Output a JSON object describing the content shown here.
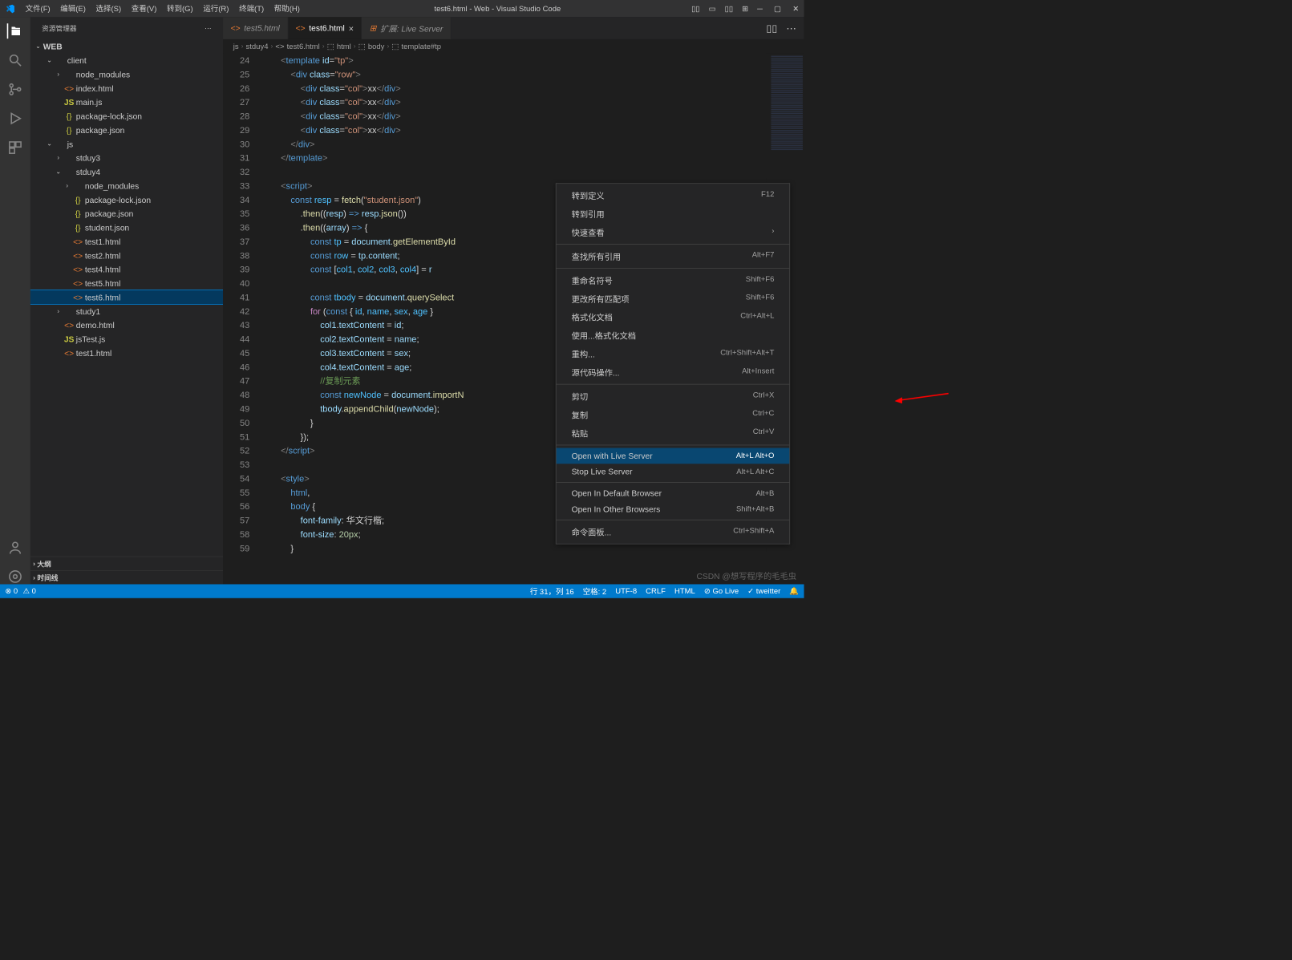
{
  "window_title": "test6.html - Web - Visual Studio Code",
  "menus": [
    "文件(F)",
    "编辑(E)",
    "选择(S)",
    "查看(V)",
    "转到(G)",
    "运行(R)",
    "终端(T)",
    "帮助(H)"
  ],
  "sidebar": {
    "title": "资源管理器",
    "root": "WEB",
    "sections": [
      "大纲",
      "时间线"
    ]
  },
  "tree": [
    {
      "depth": 1,
      "chev": "v",
      "icon": "",
      "label": "client",
      "cls": ""
    },
    {
      "depth": 2,
      "chev": ">",
      "icon": "",
      "label": "node_modules",
      "cls": ""
    },
    {
      "depth": 2,
      "chev": "",
      "icon": "<>",
      "iconcls": "icon-html",
      "label": "index.html",
      "cls": ""
    },
    {
      "depth": 2,
      "chev": "",
      "icon": "JS",
      "iconcls": "icon-js",
      "label": "main.js",
      "cls": ""
    },
    {
      "depth": 2,
      "chev": "",
      "icon": "{}",
      "iconcls": "icon-json",
      "label": "package-lock.json",
      "cls": ""
    },
    {
      "depth": 2,
      "chev": "",
      "icon": "{}",
      "iconcls": "icon-json",
      "label": "package.json",
      "cls": ""
    },
    {
      "depth": 1,
      "chev": "v",
      "icon": "",
      "label": "js",
      "cls": ""
    },
    {
      "depth": 2,
      "chev": ">",
      "icon": "",
      "label": "stduy3",
      "cls": ""
    },
    {
      "depth": 2,
      "chev": "v",
      "icon": "",
      "label": "stduy4",
      "cls": ""
    },
    {
      "depth": 3,
      "chev": ">",
      "icon": "",
      "label": "node_modules",
      "cls": ""
    },
    {
      "depth": 3,
      "chev": "",
      "icon": "{}",
      "iconcls": "icon-json",
      "label": "package-lock.json",
      "cls": ""
    },
    {
      "depth": 3,
      "chev": "",
      "icon": "{}",
      "iconcls": "icon-json",
      "label": "package.json",
      "cls": ""
    },
    {
      "depth": 3,
      "chev": "",
      "icon": "{}",
      "iconcls": "icon-json",
      "label": "student.json",
      "cls": ""
    },
    {
      "depth": 3,
      "chev": "",
      "icon": "<>",
      "iconcls": "icon-html",
      "label": "test1.html",
      "cls": ""
    },
    {
      "depth": 3,
      "chev": "",
      "icon": "<>",
      "iconcls": "icon-html",
      "label": "test2.html",
      "cls": ""
    },
    {
      "depth": 3,
      "chev": "",
      "icon": "<>",
      "iconcls": "icon-html",
      "label": "test4.html",
      "cls": ""
    },
    {
      "depth": 3,
      "chev": "",
      "icon": "<>",
      "iconcls": "icon-html",
      "label": "test5.html",
      "cls": ""
    },
    {
      "depth": 3,
      "chev": "",
      "icon": "<>",
      "iconcls": "icon-html",
      "label": "test6.html",
      "cls": "selected"
    },
    {
      "depth": 2,
      "chev": ">",
      "icon": "",
      "label": "study1",
      "cls": ""
    },
    {
      "depth": 2,
      "chev": "",
      "icon": "<>",
      "iconcls": "icon-html",
      "label": "demo.html",
      "cls": ""
    },
    {
      "depth": 2,
      "chev": "",
      "icon": "JS",
      "iconcls": "icon-js",
      "label": "jsTest.js",
      "cls": ""
    },
    {
      "depth": 2,
      "chev": "",
      "icon": "<>",
      "iconcls": "icon-html",
      "label": "test1.html",
      "cls": ""
    }
  ],
  "tabs": [
    {
      "icon": "<>",
      "label": "test5.html",
      "active": false
    },
    {
      "icon": "<>",
      "label": "test6.html",
      "active": true,
      "close": true
    },
    {
      "icon": "⊞",
      "label": "扩展: Live Server",
      "active": false,
      "italic": true
    }
  ],
  "breadcrumbs": [
    "js",
    "stduy4",
    "test6.html",
    "html",
    "body",
    "template#tp"
  ],
  "code_start_line": 24,
  "code_lines": [
    "        <span class='t-tag'>&lt;</span><span class='t-name'>template</span> <span class='t-attr'>id</span><span class='t-op'>=</span><span class='t-str'>\"tp\"</span><span class='t-tag'>&gt;</span>",
    "            <span class='t-tag'>&lt;</span><span class='t-name'>div</span> <span class='t-attr'>class</span><span class='t-op'>=</span><span class='t-str'>\"row\"</span><span class='t-tag'>&gt;</span>",
    "                <span class='t-tag'>&lt;</span><span class='t-name'>div</span> <span class='t-attr'>class</span><span class='t-op'>=</span><span class='t-str'>\"col\"</span><span class='t-tag'>&gt;</span>xx<span class='t-tag'>&lt;/</span><span class='t-name'>div</span><span class='t-tag'>&gt;</span>",
    "                <span class='t-tag'>&lt;</span><span class='t-name'>div</span> <span class='t-attr'>class</span><span class='t-op'>=</span><span class='t-str'>\"col\"</span><span class='t-tag'>&gt;</span>xx<span class='t-tag'>&lt;/</span><span class='t-name'>div</span><span class='t-tag'>&gt;</span>",
    "                <span class='t-tag'>&lt;</span><span class='t-name'>div</span> <span class='t-attr'>class</span><span class='t-op'>=</span><span class='t-str'>\"col\"</span><span class='t-tag'>&gt;</span>xx<span class='t-tag'>&lt;/</span><span class='t-name'>div</span><span class='t-tag'>&gt;</span>",
    "                <span class='t-tag'>&lt;</span><span class='t-name'>div</span> <span class='t-attr'>class</span><span class='t-op'>=</span><span class='t-str'>\"col\"</span><span class='t-tag'>&gt;</span>xx<span class='t-tag'>&lt;/</span><span class='t-name'>div</span><span class='t-tag'>&gt;</span>",
    "            <span class='t-tag'>&lt;/</span><span class='t-name'>div</span><span class='t-tag'>&gt;</span>",
    "        <span class='t-tag'>&lt;/</span><span class='t-name'>template</span><span class='t-tag'>&gt;</span>",
    "",
    "        <span class='t-tag'>&lt;</span><span class='t-name'>script</span><span class='t-tag'>&gt;</span>",
    "            <span class='t-kw'>const</span> <span class='t-const'>resp</span> <span class='t-op'>=</span> <span class='t-fn'>fetch</span>(<span class='t-str'>\"student.json\"</span>)",
    "                .<span class='t-fn'>then</span>((<span class='t-var'>resp</span>) <span class='t-kw'>=&gt;</span> <span class='t-var'>resp</span>.<span class='t-fn'>json</span>())",
    "                .<span class='t-fn'>then</span>((<span class='t-var'>array</span>) <span class='t-kw'>=&gt;</span> {",
    "                    <span class='t-kw'>const</span> <span class='t-const'>tp</span> <span class='t-op'>=</span> <span class='t-var'>document</span>.<span class='t-fn'>getElementById</span>",
    "                    <span class='t-kw'>const</span> <span class='t-const'>row</span> <span class='t-op'>=</span> <span class='t-var'>tp</span>.<span class='t-var'>content</span>;",
    "                    <span class='t-kw'>const</span> [<span class='t-const'>col1</span>, <span class='t-const'>col2</span>, <span class='t-const'>col3</span>, <span class='t-const'>col4</span>] <span class='t-op'>=</span> <span class='t-var'>r</span>",
    "",
    "                    <span class='t-kw'>const</span> <span class='t-const'>tbody</span> <span class='t-op'>=</span> <span class='t-var'>document</span>.<span class='t-fn'>querySelect</span>",
    "                    <span class='t-kw2'>for</span> (<span class='t-kw'>const</span> { <span class='t-const'>id</span>, <span class='t-const'>name</span>, <span class='t-const'>sex</span>, <span class='t-const'>age</span> }",
    "                        <span class='t-var'>col1</span>.<span class='t-var'>textContent</span> <span class='t-op'>=</span> <span class='t-var'>id</span>;",
    "                        <span class='t-var'>col2</span>.<span class='t-var'>textContent</span> <span class='t-op'>=</span> <span class='t-var'>name</span>;",
    "                        <span class='t-var'>col3</span>.<span class='t-var'>textContent</span> <span class='t-op'>=</span> <span class='t-var'>sex</span>;",
    "                        <span class='t-var'>col4</span>.<span class='t-var'>textContent</span> <span class='t-op'>=</span> <span class='t-var'>age</span>;",
    "                        <span class='t-cmt'>//复制元素</span>",
    "                        <span class='t-kw'>const</span> <span class='t-const'>newNode</span> <span class='t-op'>=</span> <span class='t-var'>document</span>.<span class='t-fn'>importN</span>",
    "                        <span class='t-var'>tbody</span>.<span class='t-fn'>appendChild</span>(<span class='t-var'>newNode</span>);",
    "                    }",
    "                });",
    "        <span class='t-tag'>&lt;/</span><span class='t-name'>script</span><span class='t-tag'>&gt;</span>",
    "",
    "        <span class='t-tag'>&lt;</span><span class='t-name'>style</span><span class='t-tag'>&gt;</span>",
    "            <span class='t-name'>html</span>,",
    "            <span class='t-name'>body</span> {",
    "                <span class='t-attr'>font-family</span>: 华文行楷;",
    "                <span class='t-attr'>font-size</span>: <span class='t-num'>20px</span>;",
    "            }"
  ],
  "context_menu": [
    {
      "label": "转到定义",
      "shortcut": "F12"
    },
    {
      "label": "转到引用",
      "shortcut": ""
    },
    {
      "label": "快速查看",
      "shortcut": "",
      "arrow": true
    },
    {
      "sep": true
    },
    {
      "label": "查找所有引用",
      "shortcut": "Alt+F7"
    },
    {
      "sep": true
    },
    {
      "label": "重命名符号",
      "shortcut": "Shift+F6"
    },
    {
      "label": "更改所有匹配项",
      "shortcut": "Shift+F6"
    },
    {
      "label": "格式化文档",
      "shortcut": "Ctrl+Alt+L"
    },
    {
      "label": "使用...格式化文档",
      "shortcut": ""
    },
    {
      "label": "重构...",
      "shortcut": "Ctrl+Shift+Alt+T"
    },
    {
      "label": "源代码操作...",
      "shortcut": "Alt+Insert"
    },
    {
      "sep": true
    },
    {
      "label": "剪切",
      "shortcut": "Ctrl+X"
    },
    {
      "label": "复制",
      "shortcut": "Ctrl+C"
    },
    {
      "label": "粘贴",
      "shortcut": "Ctrl+V"
    },
    {
      "sep": true
    },
    {
      "label": "Open with Live Server",
      "shortcut": "Alt+L Alt+O",
      "highlight": true
    },
    {
      "label": "Stop Live Server",
      "shortcut": "Alt+L Alt+C"
    },
    {
      "sep": true
    },
    {
      "label": "Open In Default Browser",
      "shortcut": "Alt+B"
    },
    {
      "label": "Open In Other Browsers",
      "shortcut": "Shift+Alt+B"
    },
    {
      "sep": true
    },
    {
      "label": "命令面板...",
      "shortcut": "Ctrl+Shift+A"
    }
  ],
  "status": {
    "errors": "⊗ 0",
    "warnings": "⚠ 0",
    "position": "行 31，列 16",
    "spaces": "空格: 2",
    "encoding": "UTF-8",
    "eol": "CRLF",
    "lang": "HTML",
    "live": "⊘ Go Live",
    "tweet": "✓ tweitter",
    "bell": "🔔"
  },
  "watermark": "CSDN @想写程序的毛毛虫"
}
